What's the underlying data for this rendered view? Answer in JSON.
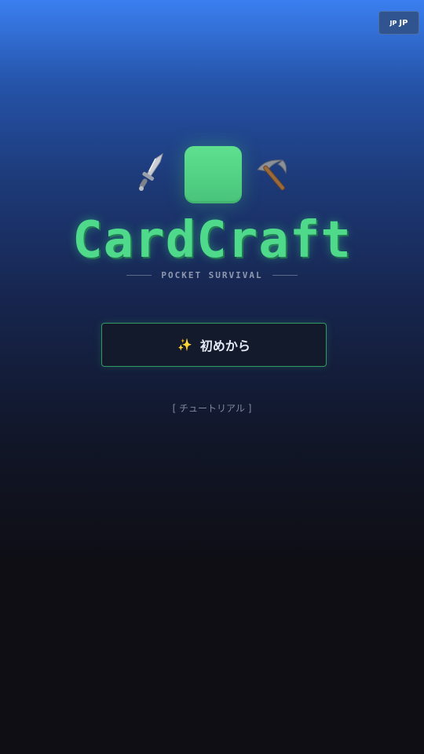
{
  "language_button": {
    "code": "JP",
    "label": "JP"
  },
  "logo": {
    "left_icon": "dagger-icon",
    "center_icon": "emerald-block-icon",
    "right_icon": "pickaxe-icon"
  },
  "title": "CardCraft",
  "subtitle": "POCKET SURVIVAL",
  "start_button": {
    "icon": "sparkle-icon",
    "icon_glyph": "✨",
    "label": "初めから"
  },
  "tutorial_link": "[ チュートリアル ]",
  "colors": {
    "title_green": "#4fd98a",
    "button_border": "#2f9a63",
    "background_top": "#3a7ff0",
    "background_bottom": "#0e0e14"
  }
}
